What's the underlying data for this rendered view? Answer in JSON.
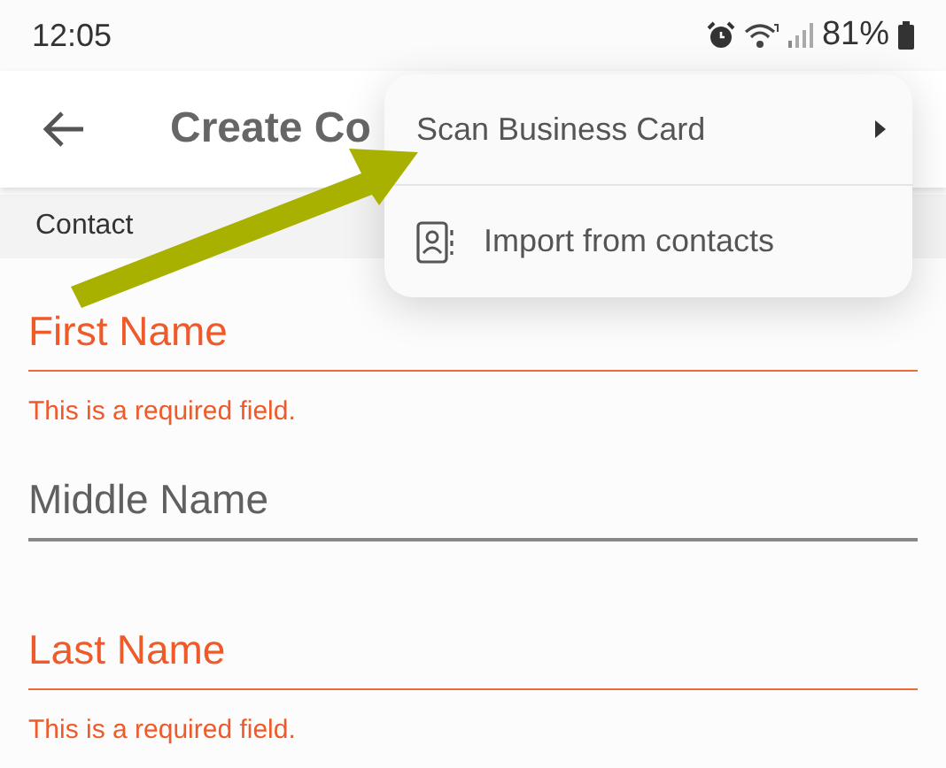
{
  "status_bar": {
    "time": "12:05",
    "battery": "81%"
  },
  "app_bar": {
    "title": "Create Co"
  },
  "section": {
    "title": "Contact"
  },
  "fields": [
    {
      "placeholder": "First Name",
      "invalid": true,
      "error": "This is a required field."
    },
    {
      "placeholder": "Middle Name",
      "invalid": false
    },
    {
      "placeholder": "Last Name",
      "invalid": true,
      "error": "This is a required field."
    }
  ],
  "menu": {
    "items": [
      {
        "label": "Scan Business Card",
        "kind": "submenu"
      },
      {
        "label": "Import from contacts",
        "kind": "contacts"
      }
    ]
  }
}
